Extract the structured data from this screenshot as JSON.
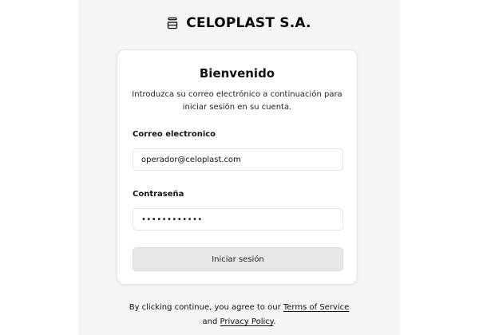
{
  "brand": {
    "icon": "database-stack-icon",
    "name": "CELOPLAST S.A."
  },
  "card": {
    "title": "Bienvenido",
    "description": "Introduzca su correo electrónico a continuación para iniciar sesión en su cuenta.",
    "email": {
      "label": "Correo electronico",
      "value": "operador@celoplast.com"
    },
    "password": {
      "label": "Contraseña",
      "value": "••••••••••••"
    },
    "submit_label": "Iniciar sesión"
  },
  "footer": {
    "prefix": "By clicking continue, you agree to our",
    "terms_link": "Terms of Service",
    "conjunction": "and",
    "privacy_link": "Privacy Policy",
    "suffix": "."
  }
}
